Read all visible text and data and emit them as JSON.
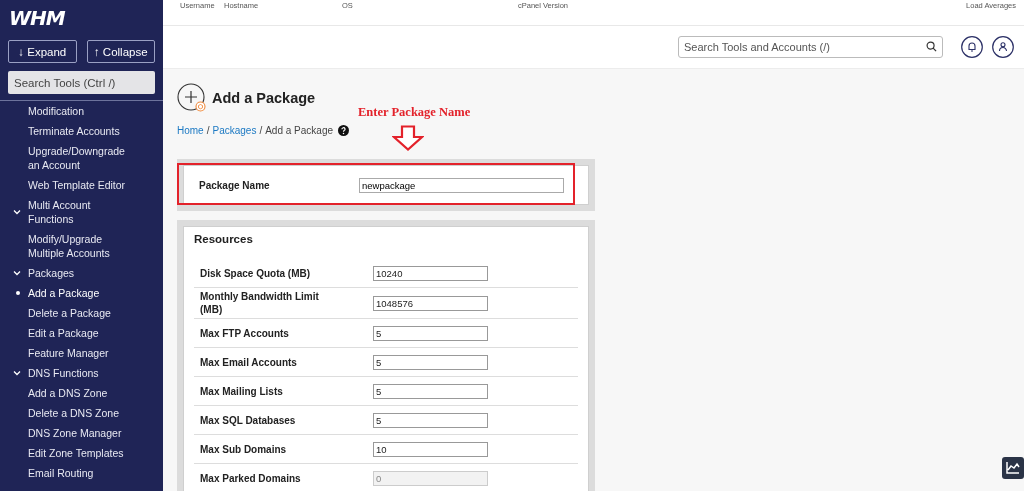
{
  "logo": {
    "text": "WHM"
  },
  "sidebar": {
    "buttons": [
      {
        "icon": "↓",
        "label": "Expand"
      },
      {
        "icon": "↑",
        "label": "Collapse"
      }
    ],
    "search": {
      "placeholder": "Search Tools (Ctrl /)"
    },
    "items": [
      {
        "label": "Modification",
        "selected": false
      },
      {
        "label": "Terminate Accounts",
        "selected": false
      },
      {
        "label": "Upgrade/Downgrade an Account",
        "selected": false
      },
      {
        "label": "Web Template Editor",
        "selected": false
      },
      {
        "label": "Multi Account Functions",
        "expanded": true,
        "children": [
          {
            "label": "Modify/Upgrade Multiple Accounts",
            "selected": false
          }
        ]
      },
      {
        "label": "Packages",
        "expanded": true,
        "children": [
          {
            "label": "Add a Package",
            "selected": true
          },
          {
            "label": "Delete a Package",
            "selected": false
          },
          {
            "label": "Edit a Package",
            "selected": false
          },
          {
            "label": "Feature Manager",
            "selected": false
          }
        ]
      },
      {
        "label": "DNS Functions",
        "expanded": true,
        "children": [
          {
            "label": "Add a DNS Zone",
            "selected": false
          },
          {
            "label": "Delete a DNS Zone",
            "selected": false
          },
          {
            "label": "DNS Zone Manager",
            "selected": false
          },
          {
            "label": "Edit Zone Templates",
            "selected": false
          },
          {
            "label": "Email Routing",
            "selected": false
          }
        ]
      }
    ]
  },
  "header": {
    "stats": [
      "Username",
      "Hostname",
      "OS",
      "cPanel Version",
      "Load Averages"
    ],
    "search": {
      "placeholder": "Search Tools and Accounts (/)"
    }
  },
  "page": {
    "title": "Add a Package",
    "breadcrumb_separator": "/",
    "breadcrumb": [
      {
        "label": "Home",
        "kind": "link"
      },
      {
        "label": "Packages",
        "kind": "link"
      },
      {
        "label": "Add a Package",
        "kind": "current"
      }
    ],
    "annotation": {
      "text": "Enter Package Name"
    },
    "package_name": {
      "label": "Package Name",
      "value": "newpackage"
    },
    "resources": {
      "title": "Resources",
      "rows": [
        {
          "label": "Disk Space Quota (MB)",
          "value": "10240",
          "disabled": false
        },
        {
          "label": "Monthly Bandwidth Limit (MB)",
          "value": "1048576",
          "disabled": false
        },
        {
          "label": "Max FTP Accounts",
          "value": "5",
          "disabled": false
        },
        {
          "label": "Max Email Accounts",
          "value": "5",
          "disabled": false
        },
        {
          "label": "Max Mailing Lists",
          "value": "5",
          "disabled": false
        },
        {
          "label": "Max SQL Databases",
          "value": "5",
          "disabled": false
        },
        {
          "label": "Max Sub Domains",
          "value": "10",
          "disabled": false
        },
        {
          "label": "Max Parked Domains",
          "value": "0",
          "disabled": true
        }
      ]
    }
  }
}
